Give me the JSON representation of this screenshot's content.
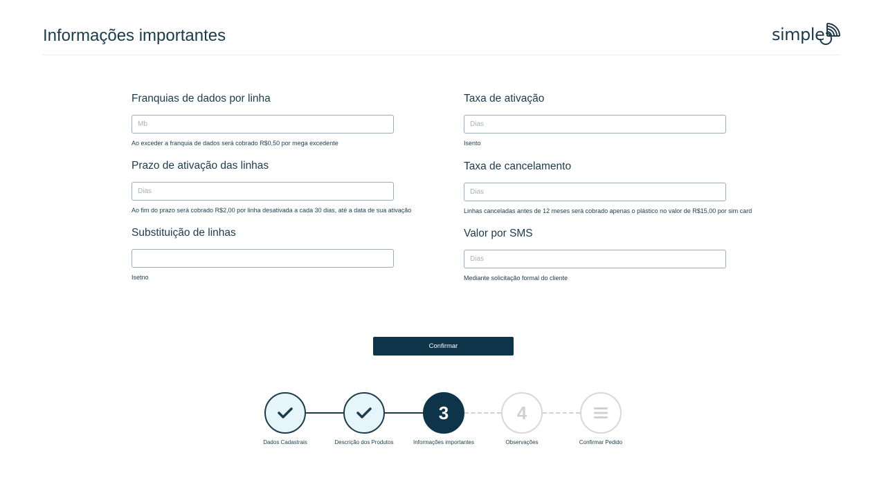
{
  "page": {
    "title": "Informações importantes",
    "logo_text": "simple"
  },
  "colors": {
    "primary": "#0d3449",
    "text": "#1a3b4c",
    "input_border": "#9aaeb5",
    "step_done_fill": "#e6f5f9",
    "step_todo": "#d8d8d8"
  },
  "fields": {
    "franquias": {
      "label": "Franquias de dados por linha",
      "placeholder": "Mb",
      "value": "",
      "hint": "Ao exceder a franquia de dados será cobrado R$0,50 por mega excedente"
    },
    "prazo": {
      "label": "Prazo de ativação das linhas",
      "placeholder": "Dias",
      "value": "",
      "hint": "Ao fim do prazo será cobrado R$2,00 por linha desativada a cada 30 dias, até a data de sua ativação"
    },
    "substituicao": {
      "label": "Substituição de linhas",
      "placeholder": "",
      "value": "",
      "hint": "Isetno"
    },
    "taxa_ativacao": {
      "label": "Taxa de ativação",
      "placeholder": "Dias",
      "value": "",
      "hint": "Isento"
    },
    "taxa_cancelamento": {
      "label": "Taxa de cancelamento",
      "placeholder": "Dias",
      "value": "",
      "hint": "Linhas canceladas antes de 12 meses será cobrado apenas o plástico no valor de R$15,00 por sim card"
    },
    "valor_sms": {
      "label": "Valor por SMS",
      "placeholder": "Dias",
      "value": "",
      "hint": "Mediante solicitação formal do cliente"
    }
  },
  "actions": {
    "confirm_label": "Confirmar"
  },
  "stepper": {
    "steps": [
      {
        "label": "Dados Cadastrais",
        "state": "done",
        "icon": "check-icon"
      },
      {
        "label": "Descrição dos Produtos",
        "state": "done",
        "icon": "check-icon"
      },
      {
        "label": "Informações importantes",
        "state": "current",
        "number": "3"
      },
      {
        "label": "Observações",
        "state": "todo",
        "number": "4"
      },
      {
        "label": "Confirmar Pedido",
        "state": "todo",
        "icon": "list-icon"
      }
    ]
  }
}
